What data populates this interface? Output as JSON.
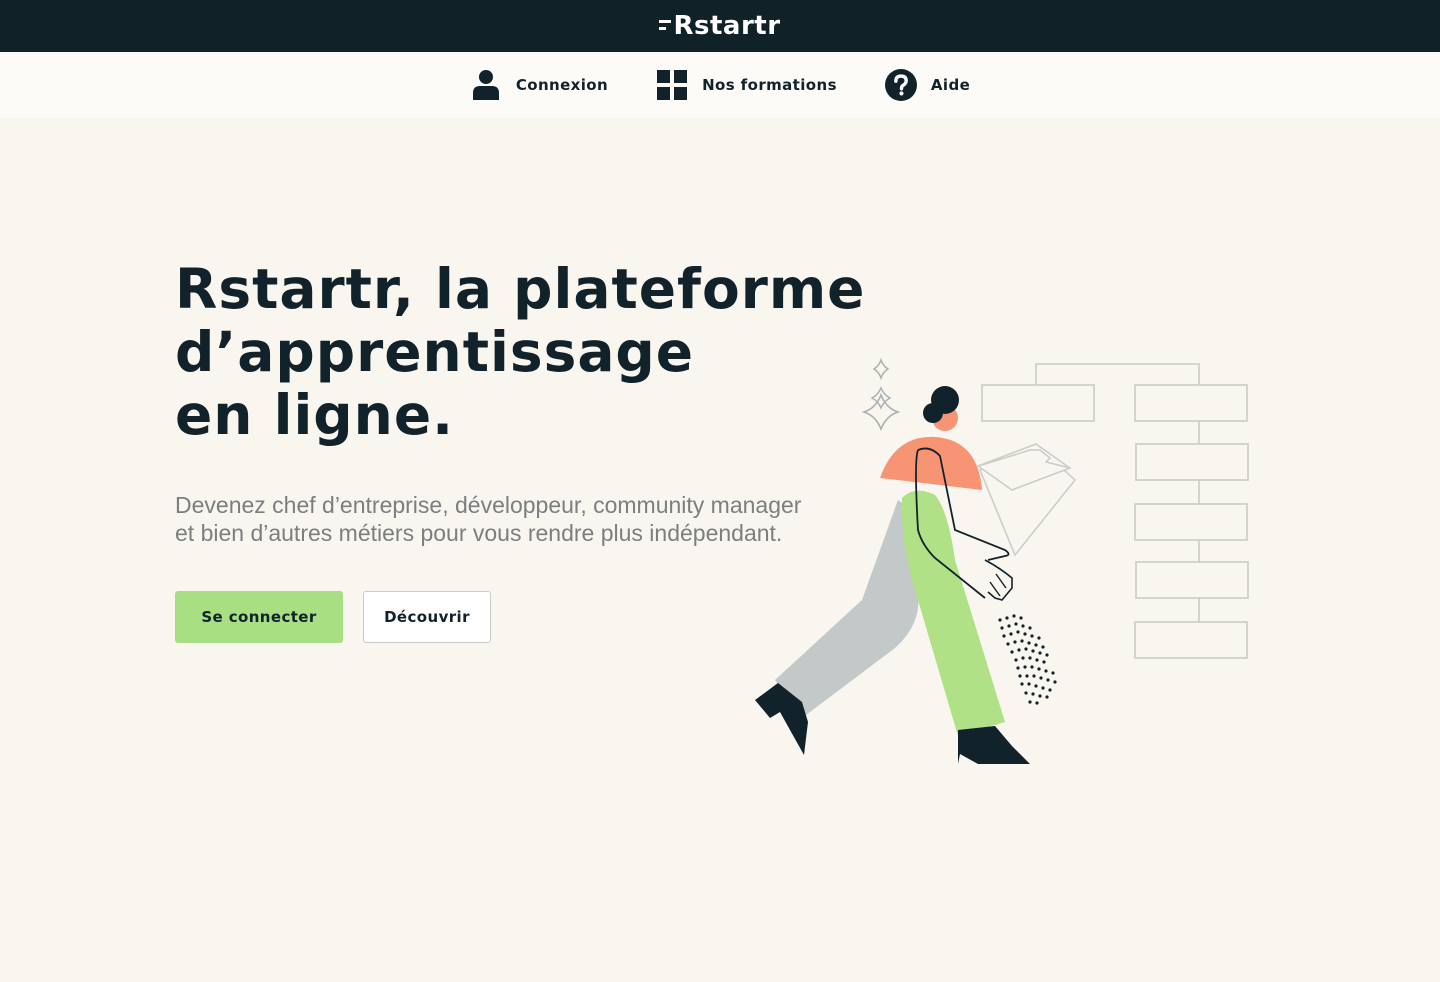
{
  "header": {
    "logo_text": "Rstartr"
  },
  "nav": {
    "items": [
      {
        "label": "Connexion",
        "icon": "user-icon"
      },
      {
        "label": "Nos formations",
        "icon": "grid-icon"
      },
      {
        "label": "Aide",
        "icon": "help-circle-icon"
      }
    ]
  },
  "hero": {
    "title_lines": [
      "Rstartr, la plateforme",
      "d’apprentissage",
      "en ligne."
    ],
    "subtitle": "Devenez chef d’entreprise, développeur, community manager et bien d’autres métiers pour vous rendre plus indépendant.",
    "primary_button": "Se connecter",
    "secondary_button": "Découvrir"
  },
  "colors": {
    "topbar": "#112128",
    "background": "#f9f5ef",
    "primary_button": "#a8df83",
    "accent_orange": "#f79473",
    "accent_green": "#b0e187"
  }
}
